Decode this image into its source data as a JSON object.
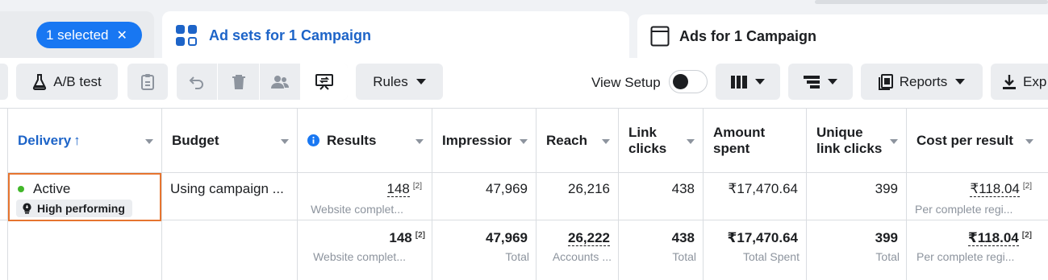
{
  "tabs": {
    "selection_label": "1 selected",
    "selection_clear": "✕",
    "adsets_label": "Ad sets for 1 Campaign",
    "ads_label": "Ads for 1 Campaign"
  },
  "toolbar": {
    "ab_test_label": "A/B test",
    "rules_label": "Rules",
    "view_setup_label": "View Setup",
    "reports_label": "Reports",
    "export_label": "Exp"
  },
  "columns": {
    "delivery": "Delivery",
    "delivery_sort": "↑",
    "budget": "Budget",
    "results": "Results",
    "impressions": "Impression",
    "reach": "Reach",
    "link_clicks_1": "Link",
    "link_clicks_2": "clicks",
    "amount_spent_1": "Amount",
    "amount_spent_2": "spent",
    "unique_link_clicks_1": "Unique",
    "unique_link_clicks_2": "link clicks",
    "cost_per_result": "Cost per result"
  },
  "row": {
    "status": "Active",
    "badge": "High performing",
    "budget": "Using campaign ...",
    "results": "148",
    "results_ref": "[2]",
    "results_sub": "Website complet...",
    "impressions": "47,969",
    "reach": "26,216",
    "link_clicks": "438",
    "amount_spent": "₹17,470.64",
    "unique_link_clicks": "399",
    "cost_per_result": "₹118.04",
    "cost_ref": "[2]",
    "cost_sub": "Per complete regi..."
  },
  "totals": {
    "results": "148",
    "results_ref": "[2]",
    "results_sub": "Website complet...",
    "impressions": "47,969",
    "impressions_sub": "Total",
    "reach": "26,222",
    "reach_sub": "Accounts ...",
    "link_clicks": "438",
    "link_clicks_sub": "Total",
    "amount_spent": "₹17,470.64",
    "amount_spent_sub": "Total Spent",
    "unique_link_clicks": "399",
    "unique_link_clicks_sub": "Total",
    "cost_per_result": "₹118.04",
    "cost_ref": "[2]",
    "cost_sub": "Per complete regi..."
  },
  "colors": {
    "accent": "#1877f2",
    "active_tab_text": "#1d64c8",
    "status_active": "#42b72a",
    "highlight_border": "#e6742f"
  }
}
